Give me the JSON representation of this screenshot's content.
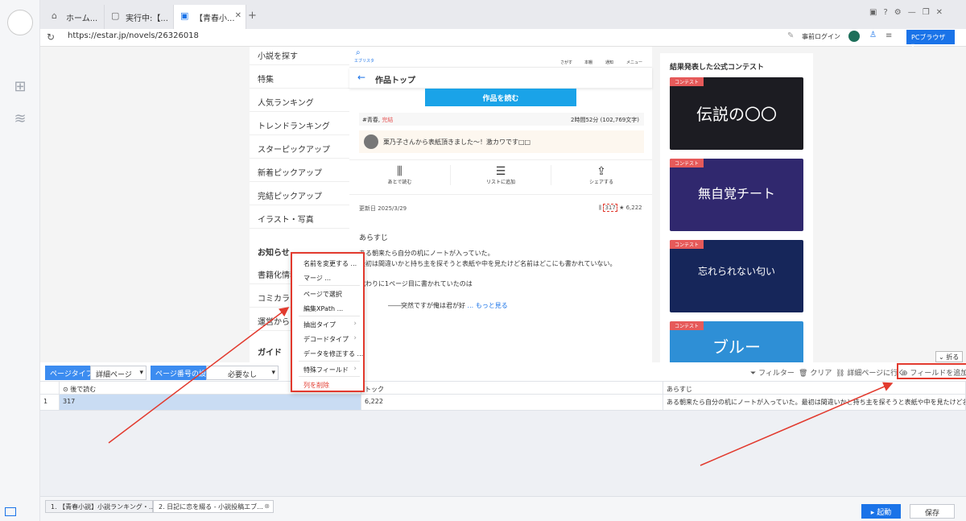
{
  "tabs": [
    {
      "label": "ホーム..."
    },
    {
      "label": "実行中:【..."
    },
    {
      "label": "【青春小..."
    }
  ],
  "address": {
    "url": "https://estar.jp/novels/26326018"
  },
  "toolbar_right": {
    "login": "事前ログイン",
    "browser": "PCブラウザ"
  },
  "site_menu": [
    "小説を探す",
    "特集",
    "人気ランキング",
    "トレンドランキング",
    "スターピックアップ",
    "新着ピックアップ",
    "完結ピックアップ",
    "イラスト・写真",
    "お知らせ",
    "書籍化情報",
    "コミカライズ",
    "運営からの...",
    "ガイド"
  ],
  "novel_page": {
    "logo": "エブリスタ",
    "nav": [
      "さがす",
      "本棚",
      "通知",
      "メニュー"
    ],
    "header_title": "作品トップ",
    "read_button": "作品を読む",
    "genre_tag": "#青春",
    "completed": "完結",
    "read_time": "2時間52分 (102,769文字)",
    "notice": "栗乃子さんから表紙頂きました〜！激カワです□□",
    "actions": [
      "あとで読む",
      "リストに追加",
      "シェアする"
    ],
    "updated": "更新日 2025/3/29",
    "bookmarks": "317",
    "stars": "6,222",
    "synopsis_title": "あらすじ",
    "synopsis_lines": [
      "ある朝来たら自分の机にノートが入っていた。",
      "最初は間違いかと持ち主を探そうと表紙や中を見たけど名前はどこにも書かれていない。",
      "代わりに1ページ目に書かれていたのは",
      "――突然ですが俺は君が好"
    ],
    "more": "... もっと見る"
  },
  "contest": {
    "heading": "結果発表した公式コンテスト",
    "banners": [
      {
        "tag": "コンテスト",
        "title": "伝説の〇〇",
        "color": "#1c1c22"
      },
      {
        "tag": "コンテスト",
        "title": "無自覚チート",
        "color": "#30286e"
      },
      {
        "tag": "コンテスト",
        "title": "忘れられない匂い",
        "color": "#16265a"
      },
      {
        "tag": "コンテスト",
        "title": "ブルー",
        "color": "#2e8fd6"
      }
    ]
  },
  "context_menu": [
    {
      "label": "名前を変更する ...",
      "sub": false
    },
    {
      "label": "マージ ...",
      "sub": false
    },
    {
      "label": "ページで選択",
      "sub": false
    },
    {
      "label": "編集XPath ...",
      "sub": false
    },
    {
      "label": "抽出タイプ",
      "sub": true
    },
    {
      "label": "デコードタイプ",
      "sub": true
    },
    {
      "label": "データを修正する ...",
      "sub": false
    },
    {
      "label": "特殊フィールド",
      "sub": true
    },
    {
      "label": "列を削除",
      "sub": false,
      "danger": true
    }
  ],
  "panel": {
    "page_type_label": "ページタイプ",
    "page_type_value": "詳細ページ",
    "page_number_label": "ページ番号の設定",
    "page_number_value": "必要なし",
    "filter": "フィルター",
    "clear": "クリア",
    "go_detail": "詳細ページに行く",
    "add_field": "フィールドを追加",
    "collapse": "折る",
    "columns": [
      "後で読む",
      "トック",
      "あらすじ"
    ],
    "rows": [
      {
        "index": "1",
        "cells": [
          "317",
          "6,222",
          "ある朝来たら自分の机にノートが入っていた。最初は間違いかと持ち主を探そうと表紙や中を見たけど名前..."
        ]
      }
    ]
  },
  "task_tabs": [
    {
      "label": "1. 【青春小説】小説ランキング・..."
    },
    {
      "label": "2. 日記に恋を綴る - 小説投稿エブ..."
    }
  ],
  "buttons": {
    "run": "起動",
    "save": "保存"
  },
  "colors": {
    "accent": "#1a73e8",
    "highlight": "#e23a2e",
    "read_button": "#1aa3e8"
  }
}
